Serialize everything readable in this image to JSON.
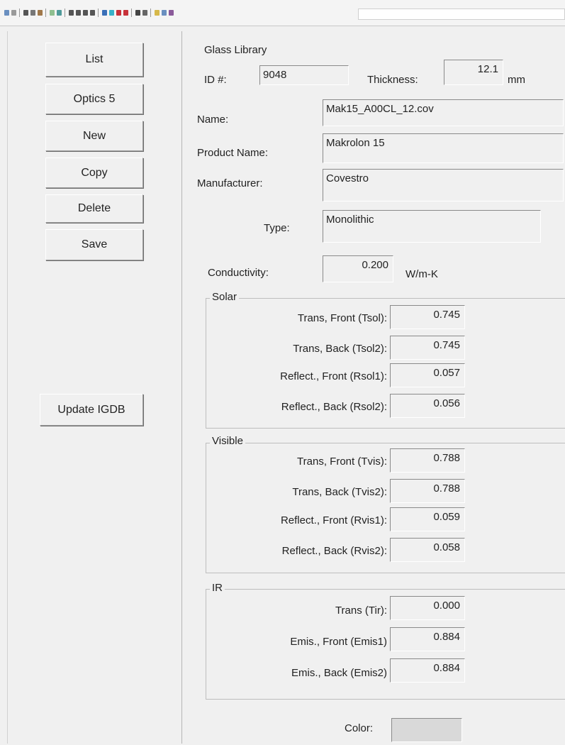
{
  "toolbar": {
    "icons": [
      "print-icon",
      "preview-icon",
      "cut-icon",
      "copy-icon",
      "paste-icon",
      "grid-icon",
      "table-icon",
      "first-record-icon",
      "prev-record-icon",
      "next-record-icon",
      "last-record-icon",
      "filter-icon",
      "sort-icon",
      "insert-icon",
      "delete-icon",
      "window-icon",
      "layout-icon",
      "tool-icon",
      "help-icon",
      "whatsthis-icon"
    ]
  },
  "left": {
    "buttons": {
      "list": "List",
      "optics": "Optics 5",
      "new": "New",
      "copy": "Copy",
      "delete": "Delete",
      "save": "Save",
      "update": "Update IGDB"
    }
  },
  "header": {
    "title": "Glass Library",
    "id_label": "ID #:",
    "id_value": "9048",
    "thickness_label": "Thickness:",
    "thickness_value": "12.1",
    "thickness_unit": "mm"
  },
  "details": {
    "name_label": "Name:",
    "name_value": "Mak15_A00CL_12.cov",
    "product_label": "Product Name:",
    "product_value": "Makrolon 15",
    "manufacturer_label": "Manufacturer:",
    "manufacturer_value": "Covestro",
    "type_label": "Type:",
    "type_value": "Monolithic",
    "conductivity_label": "Conductivity:",
    "conductivity_value": "0.200",
    "conductivity_unit": "W/m-K"
  },
  "solar": {
    "title": "Solar",
    "rows": [
      {
        "label": "Trans, Front  (Tsol):",
        "value": "0.745"
      },
      {
        "label": "Trans, Back (Tsol2):",
        "value": "0.745"
      },
      {
        "label": "Reflect., Front (Rsol1):",
        "value": "0.057"
      },
      {
        "label": "Reflect., Back (Rsol2):",
        "value": "0.056"
      }
    ]
  },
  "visible": {
    "title": "Visible",
    "rows": [
      {
        "label": "Trans, Front (Tvis):",
        "value": "0.788"
      },
      {
        "label": "Trans, Back (Tvis2):",
        "value": "0.788"
      },
      {
        "label": "Reflect., Front (Rvis1):",
        "value": "0.059"
      },
      {
        "label": "Reflect., Back (Rvis2):",
        "value": "0.058"
      }
    ]
  },
  "ir": {
    "title": "IR",
    "rows": [
      {
        "label": "Trans (Tir):",
        "value": "0.000"
      },
      {
        "label": "Emis., Front (Emis1)",
        "value": "0.884"
      },
      {
        "label": "Emis., Back (Emis2)",
        "value": "0.884"
      }
    ]
  },
  "color": {
    "label": "Color:",
    "swatch": "#d9d9d9"
  }
}
